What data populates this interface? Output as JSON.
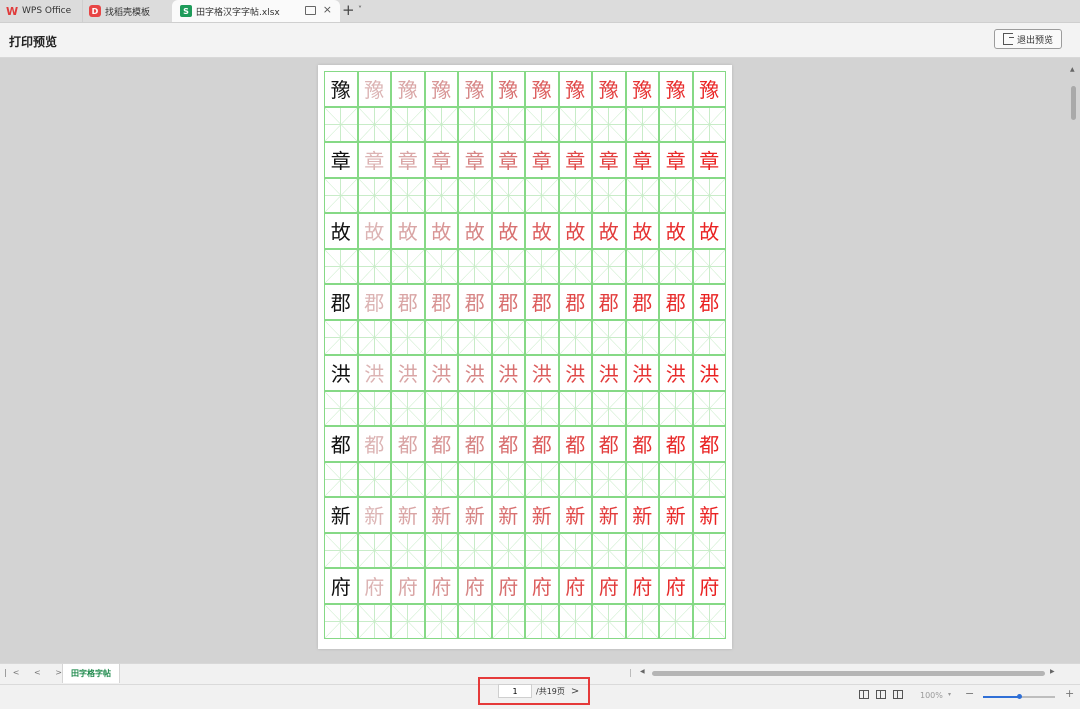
{
  "tabs": {
    "wps": "WPS Office",
    "templates": "找稻壳模板",
    "document": "田字格汉字字帖.xlsx",
    "new_tab": "+",
    "new_tab_menu": "˅",
    "close": "×"
  },
  "header": {
    "title": "打印预览",
    "exit_label": "退出预览"
  },
  "worksheet": {
    "characters": [
      "豫",
      "章",
      "故",
      "郡",
      "洪",
      "都",
      "新",
      "府"
    ],
    "columns_per_row": 12,
    "model_color": "#111111",
    "trace_colors": [
      "#dcb4b4",
      "#d9a5a5",
      "#d89595",
      "#d68585",
      "#d87070",
      "#dc5c5c",
      "#e04848",
      "#e23c3c",
      "#e63232",
      "#e82a2a",
      "#ea2222"
    ],
    "grid_color": "#86d986"
  },
  "sheet_bar": {
    "nav": "|< < > >|",
    "active_sheet": "田字格字帖"
  },
  "status": {
    "page_value": "1",
    "page_total": "/共19页",
    "next": ">",
    "zoom": "100%",
    "zoom_percent": 50
  },
  "colors": {
    "accent": "#1e9b5a",
    "highlight_box": "#e53a3a",
    "zoom_slider": "#2f6fd6"
  }
}
